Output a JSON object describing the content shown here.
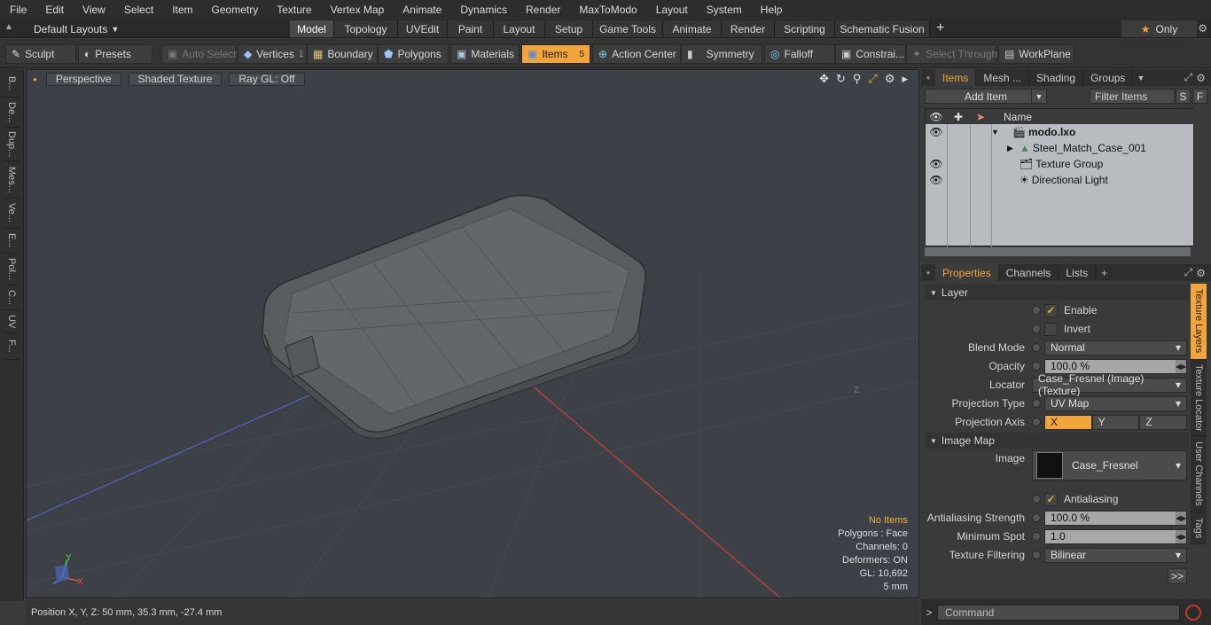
{
  "menu": [
    "File",
    "Edit",
    "View",
    "Select",
    "Item",
    "Geometry",
    "Texture",
    "Vertex Map",
    "Animate",
    "Dynamics",
    "Render",
    "MaxToModo",
    "Layout",
    "System",
    "Help"
  ],
  "layout_select": "Default Layouts",
  "tabs": [
    "Model",
    "Topology",
    "UVEdit",
    "Paint",
    "Layout",
    "Setup",
    "Game Tools",
    "Animate",
    "Render",
    "Scripting",
    "Schematic Fusion"
  ],
  "only_label": "Only",
  "toolbar": {
    "sculpt": "Sculpt",
    "presets": "Presets",
    "auto_select": "Auto Select",
    "vertices": "Vertices",
    "vertices_count": "1",
    "boundary": "Boundary",
    "polygons": "Polygons",
    "materials": "Materials",
    "items": "Items",
    "items_count": "5",
    "action_center": "Action Center",
    "symmetry": "Symmetry",
    "falloff": "Falloff",
    "constraints": "Constrai...",
    "select_through": "Select Through",
    "workplane": "WorkPlane"
  },
  "left_tabs": [
    "B...",
    "De...",
    "Dup...",
    "Mes...",
    "Ve...",
    "E...",
    "Pol...",
    "C...",
    "UV",
    "F..."
  ],
  "viewport": {
    "view": "Perspective",
    "shading": "Shaded Texture",
    "raygl": "Ray GL: Off",
    "stats": {
      "no_items": "No Items",
      "polygons": "Polygons : Face",
      "channels": "Channels: 0",
      "deformers": "Deformers: ON",
      "gl": "GL: 10,692",
      "scale": "5 mm"
    },
    "axis_z_label": "Z",
    "gizmo_y": "Y",
    "gizmo_x": "X"
  },
  "status": "Position X, Y, Z:   50 mm, 35.3 mm, -27.4 mm",
  "items_panel": {
    "tabs": [
      "Items",
      "Mesh ...",
      "Shading",
      "Groups"
    ],
    "add_item": "Add Item",
    "filter_placeholder": "Filter Items",
    "s_btn": "S",
    "f_btn": "F",
    "name_header": "Name",
    "rows": [
      "modo.lxo",
      "Steel_Match_Case_001",
      "Texture Group",
      "Directional Light"
    ]
  },
  "properties": {
    "tabs": [
      "Properties",
      "Channels",
      "Lists"
    ],
    "layer_section": "Layer",
    "enable": "Enable",
    "invert": "Invert",
    "blend_mode_label": "Blend Mode",
    "blend_mode": "Normal",
    "opacity_label": "Opacity",
    "opacity": "100.0 %",
    "locator_label": "Locator",
    "locator": "Case_Fresnel (Image) (Texture)",
    "proj_type_label": "Projection Type",
    "proj_type": "UV Map",
    "proj_axis_label": "Projection Axis",
    "axis_x": "X",
    "axis_y": "Y",
    "axis_z": "Z",
    "image_map_section": "Image Map",
    "image_label": "Image",
    "image": "Case_Fresnel",
    "antialiasing": "Antialiasing",
    "aa_strength_label": "Antialiasing Strength",
    "aa_strength": "100.0 %",
    "min_spot_label": "Minimum Spot",
    "min_spot": "1.0",
    "filtering_label": "Texture Filtering",
    "filtering": "Bilinear",
    "more": ">>"
  },
  "right_vtabs": [
    "Texture Layers",
    "Texture Locator",
    "User Channels",
    "Tags"
  ],
  "command_placeholder": "Command"
}
